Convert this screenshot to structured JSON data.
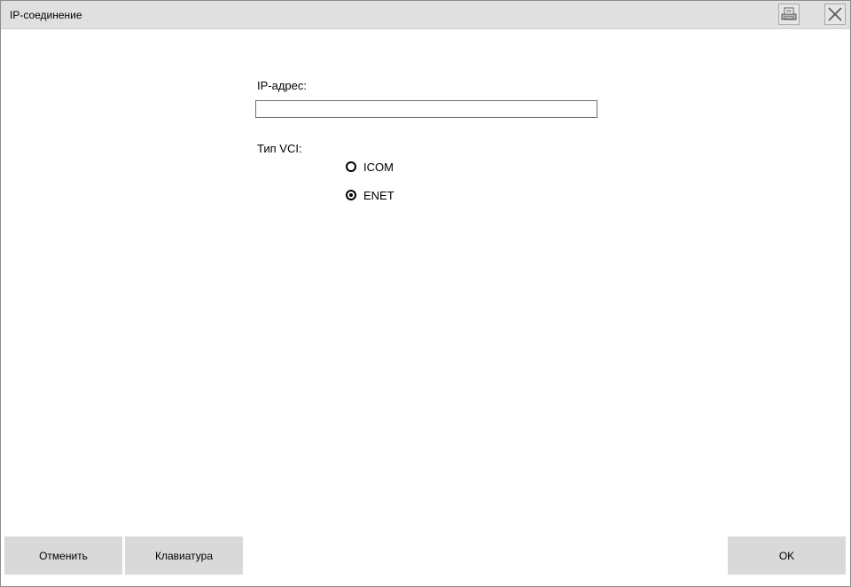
{
  "window": {
    "title": "IP-соединение",
    "icons": {
      "print": "printer-icon",
      "close": "close-icon"
    }
  },
  "form": {
    "ip_label": "IP-адрес:",
    "ip_value": "",
    "vci_label": "Тип VCI:",
    "vci_options": [
      {
        "label": "ICOM",
        "selected": false
      },
      {
        "label": "ENET",
        "selected": true
      }
    ]
  },
  "buttons": {
    "cancel": "Отменить",
    "keyboard": "Клавиатура",
    "ok": "OK"
  },
  "colors": {
    "titlebar": "#e0e0e0",
    "button": "#d9d9d9"
  }
}
